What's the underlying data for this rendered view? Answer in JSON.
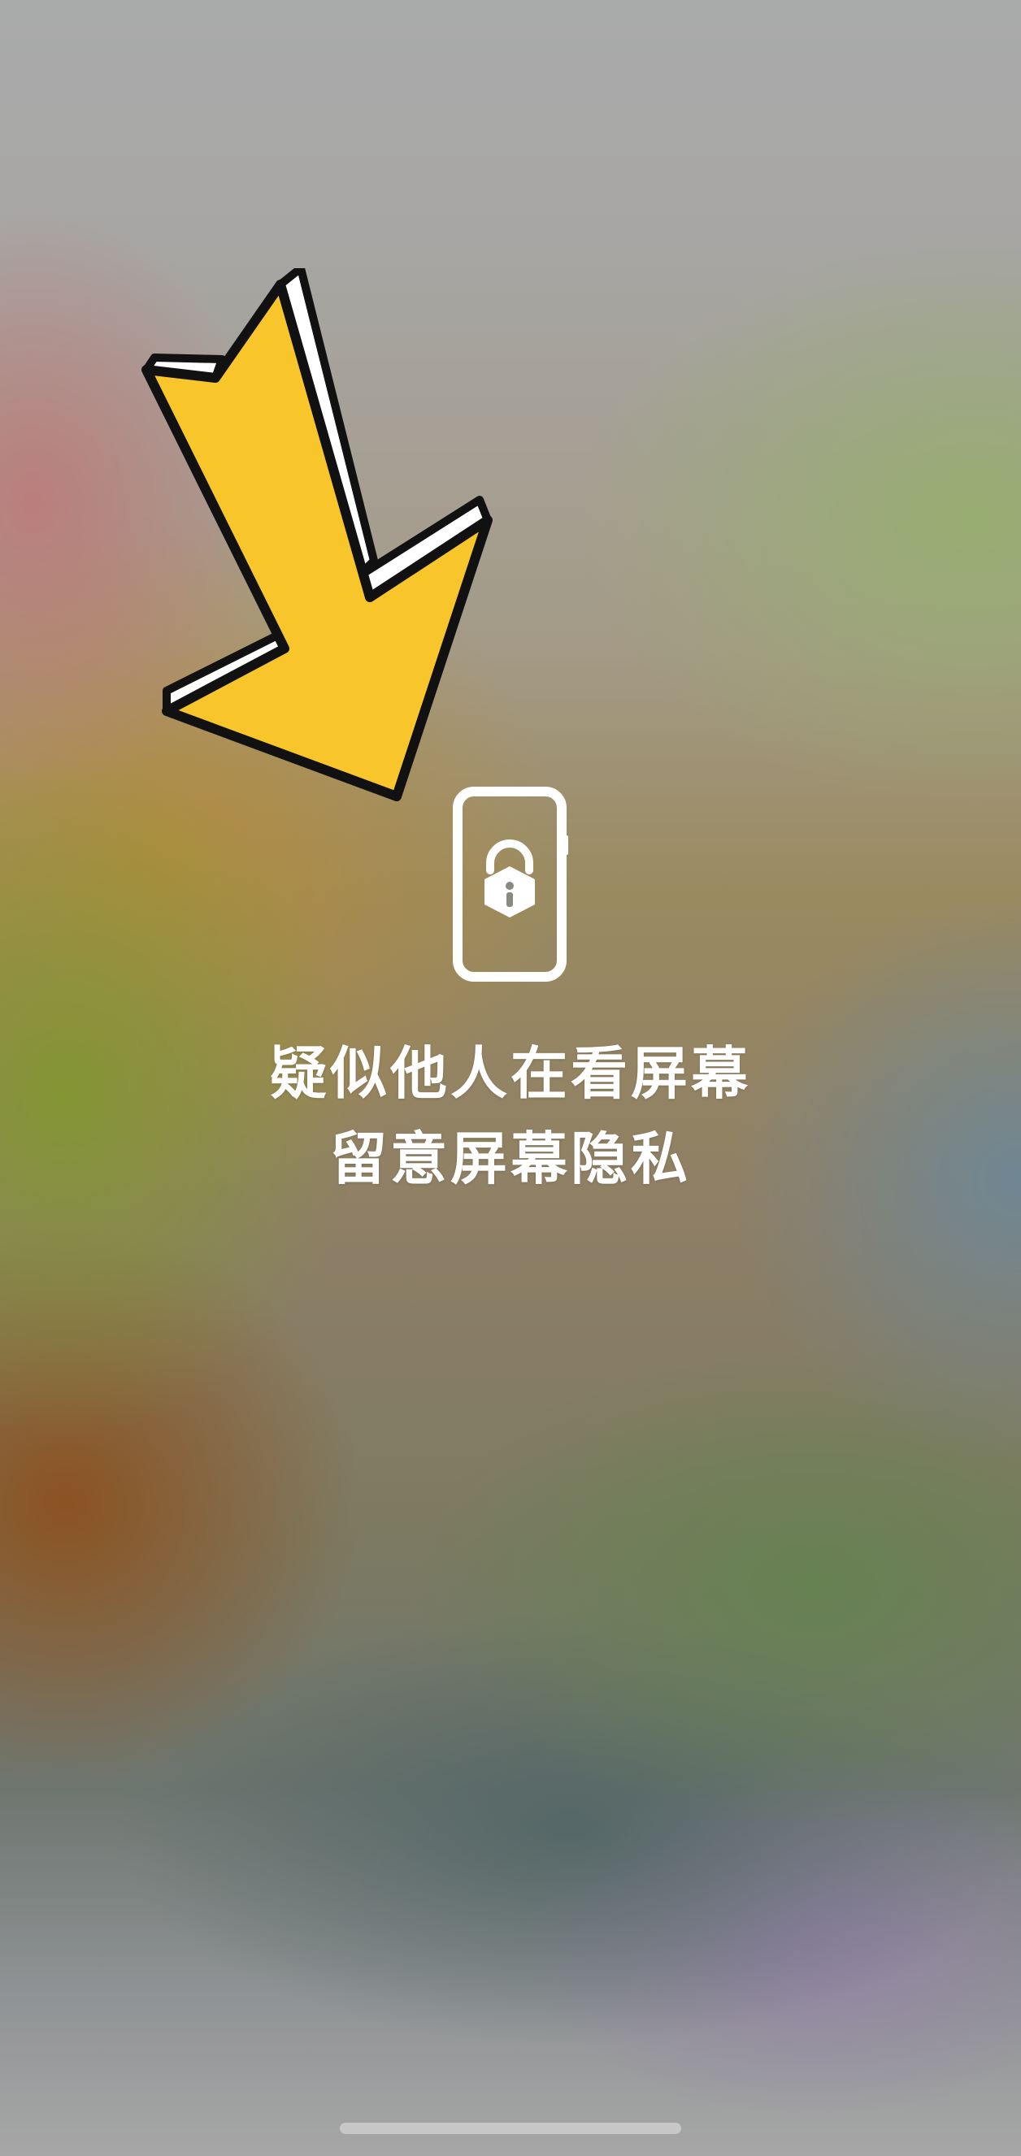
{
  "overlay": {
    "line1": "疑似他人在看屏幕",
    "line2": "留意屏幕隐私"
  },
  "icons": {
    "arrow": "yellow-arrow-icon",
    "phone_lock": "phone-lock-icon"
  },
  "colors": {
    "arrow_fill": "#F8C52B",
    "text": "#FFFFFF"
  }
}
